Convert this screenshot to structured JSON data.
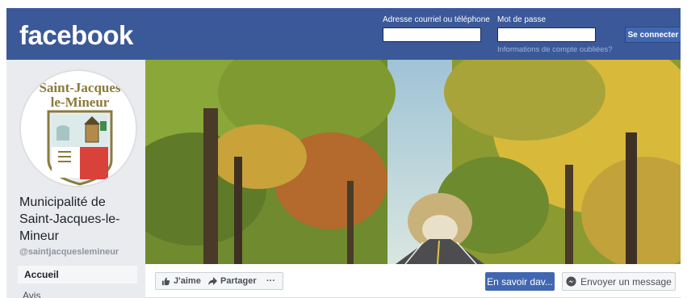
{
  "header": {
    "logo": "facebook",
    "email_label": "Adresse courriel ou téléphone",
    "password_label": "Mot de passe",
    "forgot_link": "Informations de compte oubliées?",
    "login_button": "Se connecter"
  },
  "page": {
    "name": "Municipalité de Saint-Jacques-le-Mineur",
    "handle": "@saintjacqueslemineur",
    "logo_text_line1": "Saint-Jacques",
    "logo_text_line2": "le-Mineur"
  },
  "sidebar": {
    "items": [
      {
        "label": "Accueil",
        "active": true
      },
      {
        "label": "Avis",
        "active": false
      }
    ]
  },
  "actions": {
    "like": "J'aime",
    "share": "Partager",
    "more": "···",
    "learn_more": "En savoir dav...",
    "send_message": "Envoyer un message"
  },
  "colors": {
    "brand": "#3b5998",
    "button_blue": "#4267b2",
    "page_bg": "#e9ebee"
  },
  "icons": {
    "like": "thumbs-up-icon",
    "share": "share-arrow-icon",
    "messenger": "messenger-icon"
  }
}
